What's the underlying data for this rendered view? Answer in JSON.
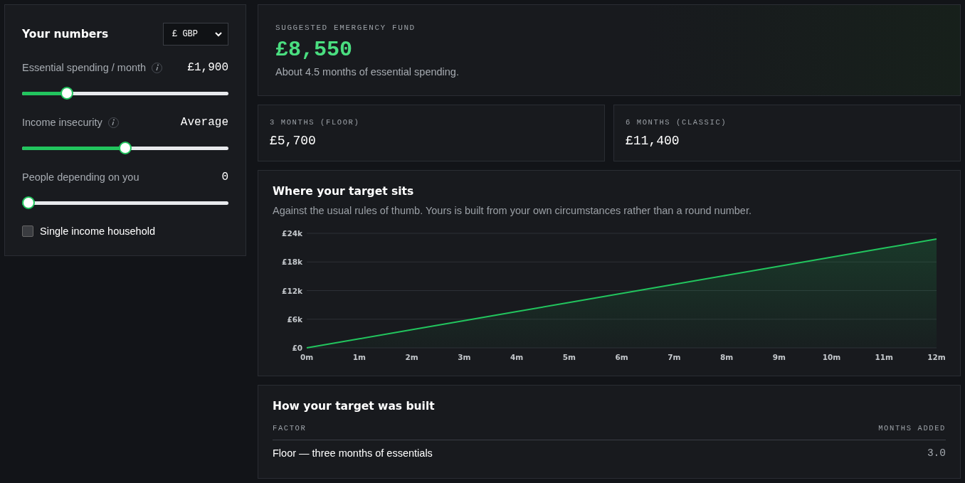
{
  "controls": {
    "title": "Your numbers",
    "currency": "£ GBP",
    "sliders": [
      {
        "label": "Essential spending / month",
        "info": true,
        "reading": "£1,900",
        "level": 0.2
      },
      {
        "label": "Income insecurity",
        "info": true,
        "reading": "Average",
        "level": 0.5
      },
      {
        "label": "People depending on you",
        "info": false,
        "reading": "0",
        "level": 0
      }
    ],
    "checkbox": {
      "label": "Single income household",
      "checked": false
    }
  },
  "hero": {
    "label": "SUGGESTED EMERGENCY FUND",
    "amount": "£8,550",
    "note": "About 4.5 months of essential spending."
  },
  "benchmarks": [
    {
      "label": "3 MONTHS (FLOOR)",
      "amount": "£5,700"
    },
    {
      "label": "6 MONTHS (CLASSIC)",
      "amount": "£11,400"
    }
  ],
  "chart_card": {
    "title": "Where your target sits",
    "subtitle": "Against the usual rules of thumb. Yours is built from your own circumstances rather than a round number.",
    "chart_data": {
      "type": "area",
      "categories": [
        "0m",
        "1m",
        "2m",
        "3m",
        "4m",
        "5m",
        "6m",
        "7m",
        "8m",
        "9m",
        "10m",
        "11m",
        "12m"
      ],
      "grid": true,
      "series": [
        {
          "color": "#22c55e",
          "values": [
            0,
            1900,
            3800,
            5700,
            7600,
            9500,
            11400,
            13300,
            15200,
            17100,
            19000,
            20900,
            22800
          ]
        }
      ],
      "ylim": [
        0,
        24000
      ],
      "yticks": [
        {
          "value": 0,
          "label": "£0"
        },
        {
          "value": 6000,
          "label": "£6k"
        },
        {
          "value": 12000,
          "label": "£12k"
        },
        {
          "value": 18000,
          "label": "£18k"
        },
        {
          "value": 24000,
          "label": "£24k"
        }
      ]
    }
  },
  "breakdown": {
    "title": "How your target was built",
    "columns": [
      "FACTOR",
      "MONTHS ADDED"
    ],
    "rows": [
      {
        "factor": "Floor — three months of essentials",
        "months": "3.0"
      }
    ]
  }
}
